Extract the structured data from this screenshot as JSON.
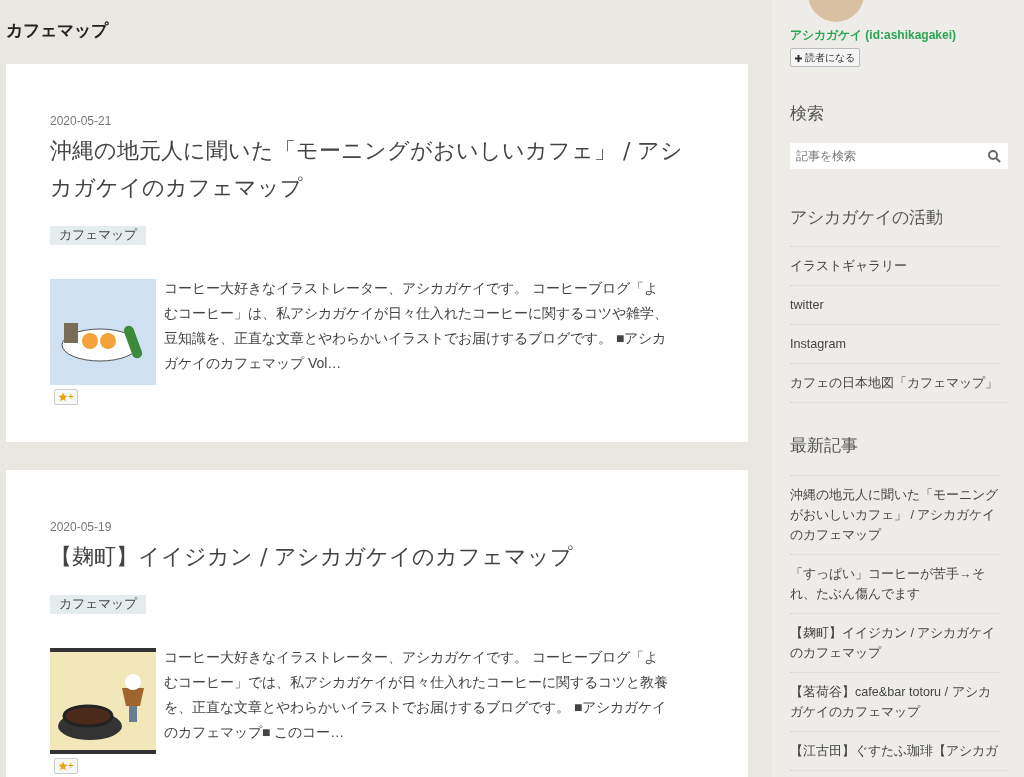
{
  "page_title": "カフェマップ",
  "articles": [
    {
      "date": "2020-05-21",
      "title": "沖縄の地元人に聞いた「モーニングがおいしいカフェ」 / アシカガケイのカフェマップ",
      "category": "カフェマップ",
      "excerpt": "コーヒー大好きなイラストレーター、アシカガケイです。 コーヒーブログ「よむコーヒー」は、私アシカガケイが日々仕入れたコーヒーに関するコツや雑学、豆知識を、正直な文章とやわらかいイラストでお届けするブログです。 ■アシカガケイのカフェマップ Vol…",
      "star_label": "+"
    },
    {
      "date": "2020-05-19",
      "title": "【麹町】イイジカン / アシカガケイのカフェマップ",
      "category": "カフェマップ",
      "excerpt": "コーヒー大好きなイラストレーター、アシカガケイです。 コーヒーブログ「よむコーヒー」では、私アシカガケイが日々仕入れたコーヒーに関するコツと教養を、正直な文章とやわらかいイラストでお届けするブログです。 ■アシカガケイのカフェマップ■ このコー…",
      "star_label": "+"
    }
  ],
  "sidebar": {
    "profile": {
      "name": "アシカガケイ (id:ashikagakei)",
      "subscribe": "読者になる"
    },
    "search": {
      "heading": "検索",
      "placeholder": "記事を検索"
    },
    "links": {
      "heading": "アシカガケイの活動",
      "items": [
        "イラストギャラリー",
        "twitter",
        "Instagram",
        "カフェの日本地図「カフェマップ」"
      ]
    },
    "recent": {
      "heading": "最新記事",
      "items": [
        "沖縄の地元人に聞いた「モーニングがおいしいカフェ」 / アシカガケイのカフェマップ",
        "「すっぱい」コーヒーが苦手→それ、たぶん傷んでます",
        "【麹町】イイジカン / アシカガケイのカフェマップ",
        "【茗荷谷】cafe&bar totoru / アシカガケイのカフェマップ",
        "【江古田】ぐすたふ珈琲【アシカガ"
      ]
    }
  }
}
